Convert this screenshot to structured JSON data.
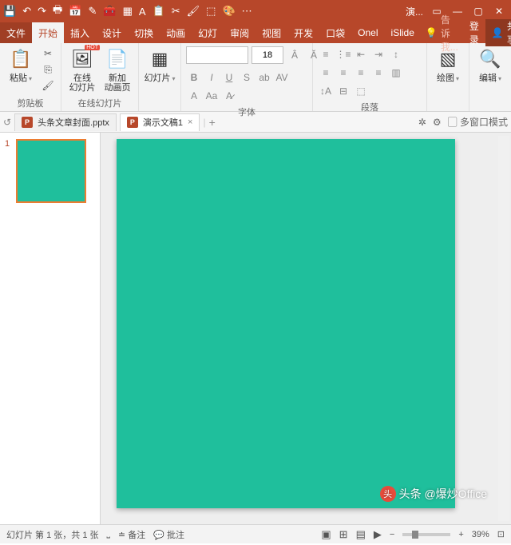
{
  "title": "演...",
  "qat": [
    "💾",
    "↶",
    "↷",
    "🖶",
    "📅",
    "✎",
    "🧰",
    "▦",
    "A",
    "📋",
    "✂",
    "🖌",
    "⬚",
    "🎨",
    "⬚",
    "⋯"
  ],
  "tabs": {
    "file": "文件",
    "items": [
      "开始",
      "插入",
      "设计",
      "切换",
      "动画",
      "幻灯",
      "审阅",
      "视图",
      "开发",
      "口袋",
      "Onel",
      "iSlide"
    ],
    "active": 0,
    "tell": "告诉我...",
    "login": "登录",
    "share": "共享"
  },
  "ribbon": {
    "clipboard": {
      "paste": "粘贴",
      "label": "剪贴板"
    },
    "onlineSlides": {
      "btn": "在线\n幻灯片",
      "label": "在线幻灯片",
      "hot": "HOT"
    },
    "newSlide": {
      "newBtn": "新加\n动画页",
      "slidesBtn": "幻灯片",
      "label": ""
    },
    "font": {
      "name": "",
      "size": "18",
      "label": "字体"
    },
    "paragraph": {
      "label": "段落"
    },
    "drawing": {
      "btn": "绘图",
      "label": ""
    },
    "editing": {
      "btn": "编辑",
      "label": ""
    }
  },
  "docs": {
    "tab1": "头条文章封面.pptx",
    "tab2": "演示文稿1",
    "multiwindow": "多窗口模式"
  },
  "thumb": {
    "num": "1"
  },
  "status": {
    "slideinfo": "幻灯片 第 1 张，共 1 张",
    "notes": "备注",
    "comments": "批注",
    "zoom": "39%"
  },
  "watermark": "头条 @爆炒Office",
  "colors": {
    "accent": "#b7472a",
    "slide": "#1fbf9c"
  }
}
